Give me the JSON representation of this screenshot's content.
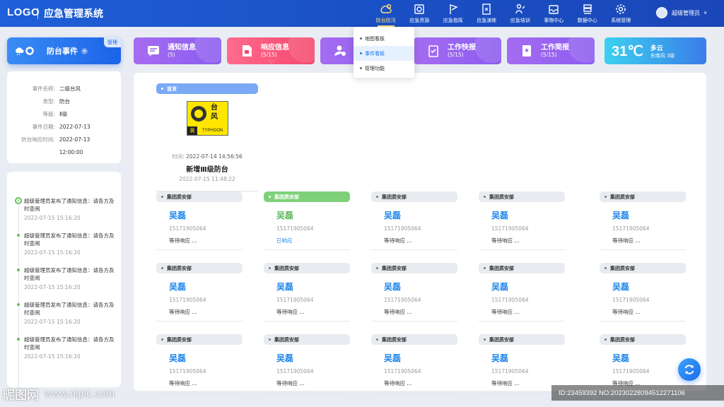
{
  "header": {
    "logo": "LOGO",
    "title": "应急管理系统",
    "nav": [
      {
        "label": "防台防汛",
        "icon": "typhoon-icon",
        "active": true
      },
      {
        "label": "应急资源",
        "icon": "resource-icon",
        "active": false
      },
      {
        "label": "应急指挥",
        "icon": "command-flag-icon",
        "active": false
      },
      {
        "label": "应急演练",
        "icon": "drill-icon",
        "active": false
      },
      {
        "label": "应急培训",
        "icon": "training-icon",
        "active": false
      },
      {
        "label": "事物中心",
        "icon": "inbox-icon",
        "active": false
      },
      {
        "label": "数据中心",
        "icon": "database-icon",
        "active": false
      },
      {
        "label": "系统管理",
        "icon": "gear-icon",
        "active": false
      }
    ],
    "user": "超级管理员"
  },
  "event_button": {
    "label": "防台事件",
    "manage": "管理"
  },
  "dropdown": [
    "地图看板",
    "事件看板",
    "管理功能"
  ],
  "tiles": [
    {
      "title": "通知信息",
      "count": "(5)",
      "colors": [
        "#a56cf0",
        "#8b5cf0"
      ],
      "icon": "chat-icon"
    },
    {
      "title": "响应信息",
      "count": "(5/15)",
      "colors": [
        "#ff6b8d",
        "#f4476e"
      ],
      "icon": "response-icon"
    },
    {
      "title": "",
      "count": "",
      "colors": [
        "#a56cf0",
        "#8b5cf0"
      ],
      "icon": "user-check-icon"
    },
    {
      "title": "工作快报",
      "count": "(5/15)",
      "colors": [
        "#a56cf0",
        "#8b5cf0"
      ],
      "icon": "clipboard-check-icon"
    },
    {
      "title": "工作简报",
      "count": "(5/15)",
      "colors": [
        "#a56cf0",
        "#8b5cf0"
      ],
      "icon": "report-icon"
    }
  ],
  "weather": {
    "temp": "31℃",
    "cond": "多云",
    "wind": "东南风  3级"
  },
  "event_info": [
    {
      "k": "事件名称:",
      "v": "二级台风"
    },
    {
      "k": "类型:",
      "v": "防台"
    },
    {
      "k": "等级:",
      "v": "Ⅱ级"
    },
    {
      "k": "事件日期:",
      "v": "2022-07-13"
    },
    {
      "k": "防台响应时间:",
      "v": "2022-07-13  12:00:00"
    }
  ],
  "timeline": [
    {
      "text": "超级管理员发布了通知信息：请各方及时查阅",
      "time": "2022-07-15  15:16:20"
    },
    {
      "text": "超级管理员发布了通知信息：请各方及时查阅",
      "time": "2022-07-15  15:16:20"
    },
    {
      "text": "超级管理员发布了通知信息：请各方及时查阅",
      "time": "2022-07-15  15:16:20"
    },
    {
      "text": "超级管理员发布了通知信息：请各方及时查阅",
      "time": "2022-07-15  15:16:20"
    },
    {
      "text": "超级管理员发布了通知信息：请各方及时查阅",
      "time": "2022-07-15  15:16:20"
    }
  ],
  "first": {
    "tag": "首发",
    "sign_zh": "台风",
    "sign_level": "黄",
    "sign_en": "TYPHOON",
    "time_label": "时间:",
    "time": "2022-07-14  14:56:56",
    "title": "新增Ⅲ级防台",
    "date": "2022-07-15  11:48:22"
  },
  "contacts": [
    {
      "dept": "集团质安部",
      "name": "吴磊",
      "phone": "15171905064",
      "status": "等待响应 ...",
      "responded": false
    },
    {
      "dept": "集团质安部",
      "name": "吴磊",
      "phone": "15171905064",
      "status": "已响应",
      "responded": true
    },
    {
      "dept": "集团质安部",
      "name": "吴磊",
      "phone": "15171905064",
      "status": "等待响应 ...",
      "responded": false
    },
    {
      "dept": "集团质安部",
      "name": "吴磊",
      "phone": "15171905064",
      "status": "等待响应 ...",
      "responded": false
    },
    {
      "dept": "集团质安部",
      "name": "吴磊",
      "phone": "15171905064",
      "status": "等待响应 ...",
      "responded": false
    },
    {
      "dept": "集团质安部",
      "name": "吴磊",
      "phone": "15171905064",
      "status": "等待响应 ...",
      "responded": false
    },
    {
      "dept": "集团质安部",
      "name": "吴磊",
      "phone": "15171905064",
      "status": "等待响应 ...",
      "responded": false
    },
    {
      "dept": "集团质安部",
      "name": "吴磊",
      "phone": "15171905064",
      "status": "等待响应 ...",
      "responded": false
    },
    {
      "dept": "集团质安部",
      "name": "吴磊",
      "phone": "15171905064",
      "status": "等待响应 ...",
      "responded": false
    },
    {
      "dept": "集团质安部",
      "name": "吴磊",
      "phone": "15171905064",
      "status": "等待响应 ...",
      "responded": false
    },
    {
      "dept": "集团质安部",
      "name": "吴磊",
      "phone": "15171905064",
      "status": "等待响应 ...",
      "responded": false
    },
    {
      "dept": "集团质安部",
      "name": "吴磊",
      "phone": "15171905064",
      "status": "等待响应 ...",
      "responded": false
    },
    {
      "dept": "集团质安部",
      "name": "吴磊",
      "phone": "15171905064",
      "status": "等待响应 ...",
      "responded": false
    },
    {
      "dept": "集团质安部",
      "name": "吴磊",
      "phone": "15171905064",
      "status": "等待响应 ...",
      "responded": false
    },
    {
      "dept": "集团质安部",
      "name": "吴磊",
      "phone": "15171905064",
      "status": "等待响应 ...",
      "responded": false
    }
  ],
  "watermark": {
    "brand": "昵图网",
    "url": "www.nipic.com",
    "id": "ID:23459392 NO:20230228094512271106"
  }
}
